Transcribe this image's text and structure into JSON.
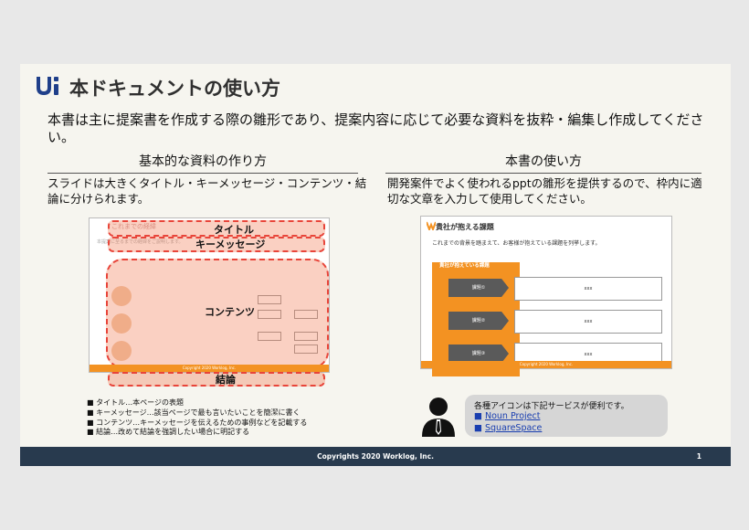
{
  "header": {
    "title": "本ドキュメントの使い方"
  },
  "intro": "本書は主に提案書を作成する際の雛形であり、提案内容に応じて必要な資料を抜粋・編集し作成してください。",
  "left_section": {
    "heading": "基本的な資料の作り方",
    "description": "スライドは大きくタイトル・キーメッセージ・コンテンツ・結論に分けられます。",
    "thumb": {
      "title_text": "これまでの経緯",
      "subtitle_text": "本提案に至るまでの経緯をご説明します。",
      "overlay_labels": [
        "タイトル",
        "キーメッセージ",
        "コンテンツ",
        "結論"
      ],
      "footer_text": "Copyright 2020 Worklog, Inc."
    },
    "bullets": [
      "タイトル…本ページの表題",
      "キーメッセージ…該当ページで最も言いたいことを簡潔に書く",
      "コンテンツ…キーメッセージを伝えるための事例などを記載する",
      "結論…改めて結論を強調したい場合に明記する"
    ]
  },
  "right_section": {
    "heading": "本書の使い方",
    "description": "開発案件でよく使われるpptの雛形を提供するので、枠内に適切な文章を入力して使用してください。",
    "thumb": {
      "title": "貴社が抱える課題",
      "subtitle": "これまでの背景を踏まえて、お客様が抱えている課題を列挙します。",
      "panel_label": "貴社が抱えている課題",
      "rows": [
        {
          "label": "課題①",
          "value": "xxx"
        },
        {
          "label": "課題②",
          "value": "xxx"
        },
        {
          "label": "課題③",
          "value": "xxx"
        }
      ],
      "footer_text": "Copyright 2020 Worklog, Inc."
    },
    "tip": {
      "text": "各種アイコンは下記サービスが便利です。",
      "links": [
        "Noun Project",
        "SquareSpace"
      ]
    }
  },
  "footer": {
    "copyright": "Copyrights 2020 Worklog, Inc.",
    "page": "1"
  },
  "colors": {
    "accent_orange": "#f39222",
    "footer_navy": "#283a4e",
    "overlay_red": "#e8453a",
    "logo_blue": "#1f3f8a"
  }
}
